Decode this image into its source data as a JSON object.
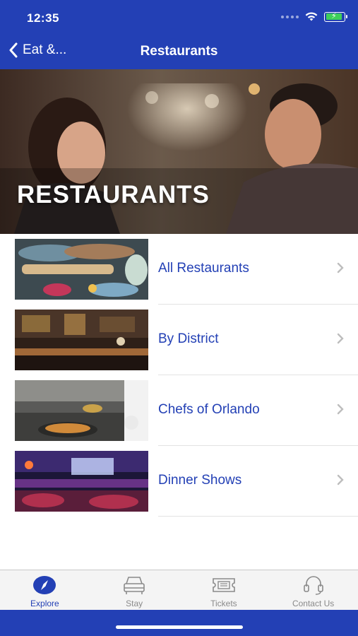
{
  "status_bar": {
    "time": "12:35"
  },
  "nav": {
    "back_label": "Eat &...",
    "title": "Restaurants"
  },
  "hero": {
    "title": "RESTAURANTS"
  },
  "list": [
    {
      "label": "All Restaurants"
    },
    {
      "label": "By District"
    },
    {
      "label": "Chefs of Orlando"
    },
    {
      "label": "Dinner Shows"
    }
  ],
  "tabs": [
    {
      "label": "Explore",
      "icon": "compass-icon",
      "active": true
    },
    {
      "label": "Stay",
      "icon": "bed-icon",
      "active": false
    },
    {
      "label": "Tickets",
      "icon": "ticket-icon",
      "active": false
    },
    {
      "label": "Contact Us",
      "icon": "headset-icon",
      "active": false
    }
  ],
  "colors": {
    "brand_blue": "#2340b5",
    "tab_inactive": "#8a8a8a"
  }
}
